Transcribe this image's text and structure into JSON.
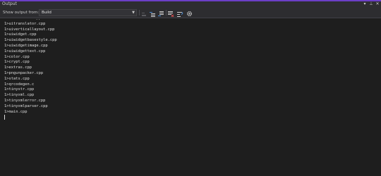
{
  "window": {
    "title": "Output",
    "controls": {
      "dropdown": "▾",
      "pin": "⊥",
      "close": "✕"
    }
  },
  "toolbar": {
    "show_label": "Show output from:",
    "source": "Build",
    "buttons": [
      {
        "name": "find-message-in-code-icon"
      },
      {
        "name": "go-to-previous-message-icon"
      },
      {
        "name": "go-to-next-message-icon"
      },
      {
        "name": "clear-all-icon"
      },
      {
        "name": "toggle-word-wrap-icon"
      },
      {
        "name": "settings-icon"
      }
    ]
  },
  "output": {
    "lines": [
      "1>uitextedit.cpp",
      "1>uitranslator.cpp",
      "1>uiverticallayout.cpp",
      "1>uiwidget.cpp",
      "1>uiwidgetbasestyle.cpp",
      "1>uiwidgetimage.cpp",
      "1>uiwidgettext.cpp",
      "1>color.cpp",
      "1>crypt.cpp",
      "1>extras.cpp",
      "1>pngunpacker.cpp",
      "1>stats.cpp",
      "1>qrcodegen.c",
      "1>tinystr.cpp",
      "1>tinyxml.cpp",
      "1>tinyxmlerror.cpp",
      "1>tinyxmlparser.cpp",
      "1>main.cpp"
    ]
  },
  "colors": {
    "accent": "#6c3fc7",
    "background": "#1e1e1e",
    "toolbar": "#2d2d30",
    "text": "#dcdcdc"
  }
}
